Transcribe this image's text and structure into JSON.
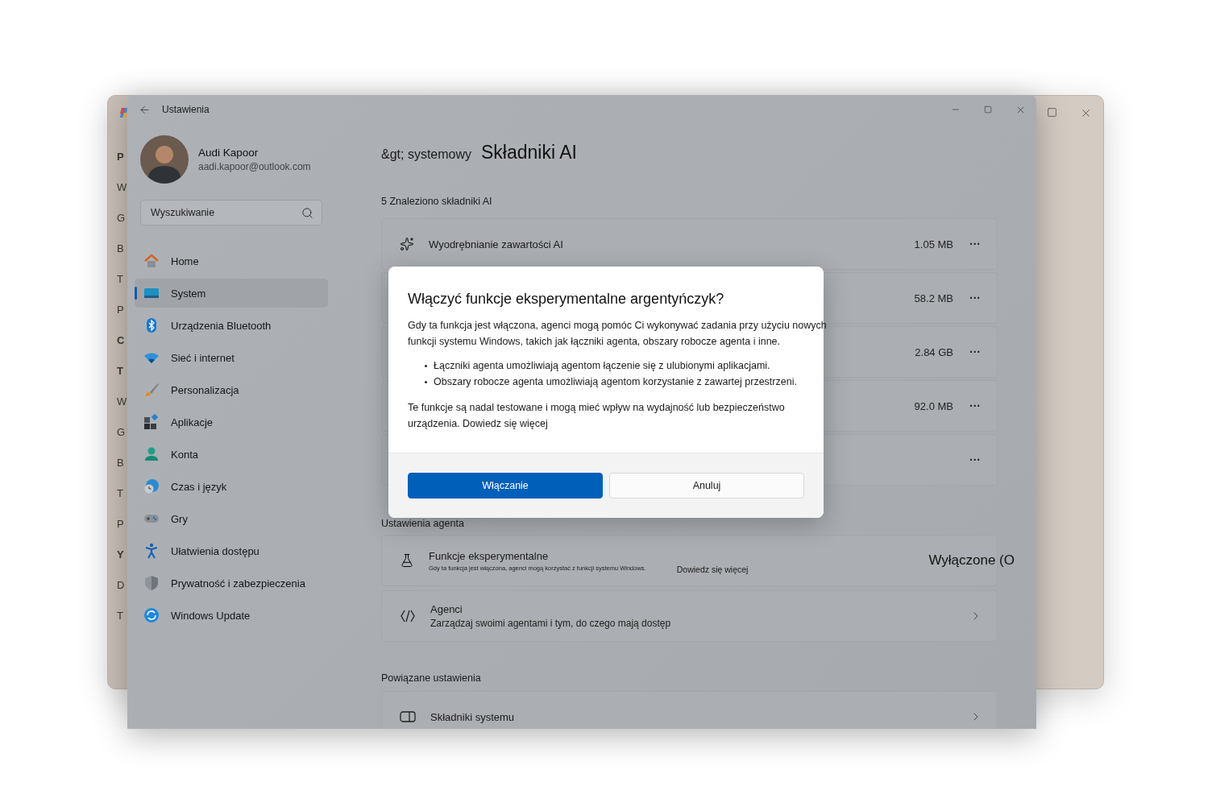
{
  "back_window": {
    "sidebar_letters": [
      {
        "text": "P",
        "bold": true
      },
      {
        "text": "W",
        "bold": false
      },
      {
        "text": "G",
        "bold": false
      },
      {
        "text": "B",
        "bold": false
      },
      {
        "text": "T",
        "bold": false
      },
      {
        "text": "P",
        "bold": false
      },
      {
        "text": "C",
        "bold": true
      },
      {
        "text": "T",
        "bold": true
      },
      {
        "text": "W",
        "bold": false
      },
      {
        "text": "G",
        "bold": false
      },
      {
        "text": "B",
        "bold": false
      },
      {
        "text": "T",
        "bold": false
      },
      {
        "text": "P",
        "bold": false
      },
      {
        "text": "Y",
        "bold": true
      },
      {
        "text": "D",
        "bold": false
      },
      {
        "text": "T",
        "bold": false
      }
    ]
  },
  "window": {
    "title": "Ustawienia"
  },
  "account": {
    "name": "Audi Kapoor",
    "email": "aadi.kapoor@outlook.com"
  },
  "search": {
    "placeholder": "Wyszukiwanie"
  },
  "sidebar": {
    "items": [
      {
        "label": "Home",
        "kind": "home",
        "selected": false
      },
      {
        "label": "System",
        "kind": "system",
        "selected": true
      },
      {
        "label": "Urządzenia Bluetooth",
        "kind": "bluetooth",
        "selected": false
      },
      {
        "label": "Sieć i internet",
        "kind": "network",
        "selected": false
      },
      {
        "label": "Personalizacja",
        "kind": "brush",
        "selected": false
      },
      {
        "label": "Aplikacje",
        "kind": "apps",
        "selected": false
      },
      {
        "label": "Konta",
        "kind": "accounts",
        "selected": false
      },
      {
        "label": "Czas i język",
        "kind": "time",
        "selected": false
      },
      {
        "label": "Gry",
        "kind": "games",
        "selected": false
      },
      {
        "label": "Ułatwienia dostępu",
        "kind": "accessibility",
        "selected": false
      },
      {
        "label": "Prywatność i zabezpieczenia",
        "kind": "privacy",
        "selected": false
      },
      {
        "label": "Windows Update",
        "kind": "update",
        "selected": false
      }
    ]
  },
  "header": {
    "breadcrumb": "&gt; systemowy",
    "title": "Składniki AI"
  },
  "components": {
    "count_label": "5 Znaleziono składniki AI",
    "items": [
      {
        "name": "Wyodrębnianie zawartości AI",
        "size": "1.05 MB",
        "more": "···"
      },
      {
        "size": "58.2 MB",
        "more": "···"
      },
      {
        "size": "2.84 GB",
        "more": "···"
      },
      {
        "size": "92.0 MB",
        "more": "···"
      },
      {
        "more": "···"
      }
    ]
  },
  "agent_settings": {
    "heading": "Ustawienia agenta",
    "experimental": {
      "title": "Funkcje eksperymentalne",
      "description": "Gdy ta funkcja jest włączona, agenci mogą korzystać z funkcji systemu Windows.",
      "link": "Dowiedz się więcej",
      "state_label": "Wyłączone (O"
    },
    "agents": {
      "title": "Agenci",
      "description": "Zarządzaj swoimi agentami i tym, do czego mają dostęp"
    }
  },
  "related": {
    "heading": "Powiązane ustawienia",
    "items": [
      {
        "title": "Składniki systemu"
      }
    ]
  },
  "dialog": {
    "title": "Włączyć funkcje eksperymentalne argentyńczyk?",
    "body": "Gdy ta funkcja jest włączona, agenci mogą pomóc Ci wykonywać zadania przy użyciu nowych funkcji systemu Windows, takich jak łączniki agenta, obszary robocze agenta i inne.",
    "bullets": [
      "Łączniki agenta umożliwiają agentom łączenie się z ulubionymi aplikacjami.",
      "Obszary robocze agenta umożliwiają agentom korzystanie z zawartej przestrzeni."
    ],
    "note": "Te funkcje są nadal testowane i mogą mieć wpływ na wydajność lub bezpieczeństwo urządzenia. Dowiedz się więcej",
    "buttons": [
      {
        "label": "Włączanie",
        "kind": "primary"
      },
      {
        "label": "Anuluj",
        "kind": "secondary"
      }
    ]
  }
}
